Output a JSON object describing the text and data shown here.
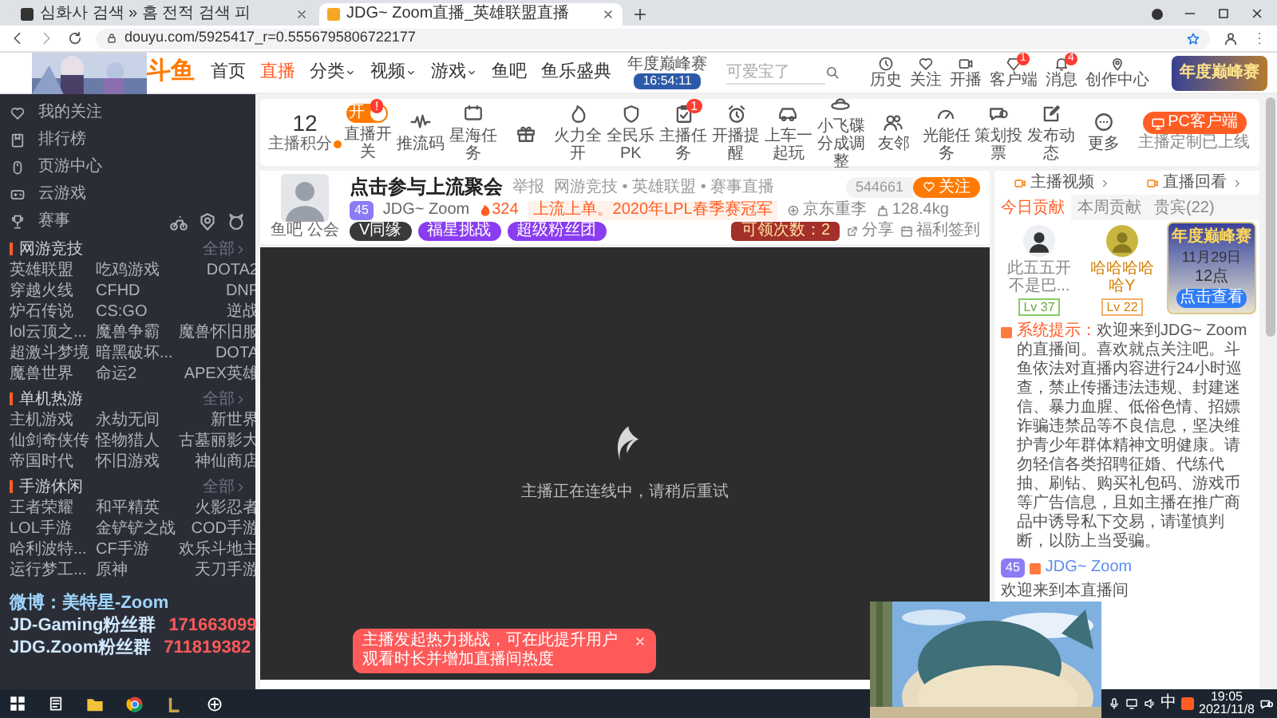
{
  "browser": {
    "tabs": [
      {
        "title": "심화사 검색 » 홈 전적 검색 피",
        "selected": false
      },
      {
        "title": "JDG~ Zoom直播_英雄联盟直播",
        "selected": true
      }
    ],
    "url": "douyu.com/5925417_r=0.5556795806722177"
  },
  "header": {
    "logo": "斗鱼",
    "nav": [
      {
        "label": "首页",
        "selected": false,
        "dropdown": false
      },
      {
        "label": "直播",
        "selected": true,
        "dropdown": false
      },
      {
        "label": "分类",
        "selected": false,
        "dropdown": true
      },
      {
        "label": "视频",
        "selected": false,
        "dropdown": true
      },
      {
        "label": "游戏",
        "selected": false,
        "dropdown": true
      },
      {
        "label": "鱼吧",
        "selected": false,
        "dropdown": false
      },
      {
        "label": "鱼乐盛典",
        "selected": false,
        "dropdown": false
      }
    ],
    "event": {
      "title": "年度巅峰赛",
      "countdown": "16:54:11"
    },
    "search": {
      "placeholder": "可爱宝了"
    },
    "actions": [
      {
        "label": "历史"
      },
      {
        "label": "关注"
      },
      {
        "label": "开播"
      },
      {
        "label": "客户端",
        "badge": "1"
      },
      {
        "label": "消息",
        "badge": "4"
      },
      {
        "label": "创作中心"
      }
    ],
    "promo": "年度巅峰赛"
  },
  "sidebar": {
    "nav": [
      {
        "label": "我的关注"
      },
      {
        "label": "排行榜"
      },
      {
        "label": "页游中心"
      },
      {
        "label": "云游戏"
      },
      {
        "label": "赛事"
      }
    ],
    "sections": [
      {
        "title": "网游竞技",
        "more": "全部",
        "items": [
          "英雄联盟",
          "吃鸡游戏",
          "DOTA2",
          "穿越火线",
          "CFHD",
          "DNF",
          "炉石传说",
          "CS:GO",
          "逆战",
          "lol云顶之...",
          "魔兽争霸",
          "魔兽怀旧服",
          "超激斗梦境",
          "暗黑破坏...",
          "DOTA",
          "魔兽世界",
          "命运2",
          "APEX英雄"
        ]
      },
      {
        "title": "单机热游",
        "more": "全部",
        "items": [
          "主机游戏",
          "永劫无间",
          "新世界",
          "仙剑奇侠传",
          "怪物猎人",
          "古墓丽影大",
          "帝国时代",
          "怀旧游戏",
          "神仙商店"
        ]
      },
      {
        "title": "手游休闲",
        "more": "全部",
        "items": [
          "王者荣耀",
          "和平精英",
          "火影忍者",
          "LOL手游",
          "金铲铲之战",
          "COD手游",
          "哈利波特...",
          "CF手游",
          "欢乐斗地主",
          "运行梦工...",
          "原神",
          "天刀手游"
        ]
      }
    ],
    "overlay": {
      "weibo": "微博：美特星-Zoom",
      "groups": [
        {
          "name": "JD-Gaming粉丝群",
          "number": "171663099"
        },
        {
          "name": "JDG.Zoom粉丝群",
          "number": "711819382"
        }
      ]
    }
  },
  "toolbar": {
    "score": {
      "value": "12",
      "label": "主播积分"
    },
    "tools": [
      {
        "kind": "toggle",
        "label": "直播开关",
        "toggle_text": "开",
        "on": true,
        "badge": "!"
      },
      {
        "kind": "button",
        "label": "推流码"
      },
      {
        "kind": "button",
        "label": "星海任务"
      },
      {
        "kind": "button"
      },
      {
        "kind": "button",
        "label": "火力全开"
      },
      {
        "kind": "button",
        "label": "全民乐PK"
      },
      {
        "kind": "button",
        "label": "主播任务",
        "badge": "1"
      },
      {
        "kind": "button",
        "label": "开播提醒"
      },
      {
        "kind": "button",
        "label": "上车一起玩"
      },
      {
        "kind": "button",
        "label": "小飞碟分成调整"
      },
      {
        "kind": "button",
        "label": "友邻"
      },
      {
        "kind": "button",
        "label": "光能任务"
      },
      {
        "kind": "button",
        "label": "策划投票"
      },
      {
        "kind": "button",
        "label": "发布动态"
      },
      {
        "kind": "button",
        "label": "更多"
      }
    ],
    "pc_client": {
      "label": "PC客户端",
      "note": "主播定制已上线"
    }
  },
  "streamer": {
    "avatar_labels": [
      "鱼吧",
      "公会"
    ],
    "title": "点击参与上流聚会",
    "report": "举报",
    "category": "网游竞技 • 英雄联盟 • 赛事直播",
    "level": "45",
    "name": "JDG~ Zoom",
    "heat": "324",
    "tagline": "上流上单。2020年LPL春季赛冠军",
    "location": "京东重李",
    "weight": "128.4kg",
    "badges": [
      "V同缘",
      "福星挑战",
      "超级粉丝团"
    ],
    "followers": "544661",
    "follow": "关注",
    "claim": "可领次数：2",
    "share": "分享",
    "checkin": "福利签到"
  },
  "video": {
    "status": "主播正在连线中，请稍后重试",
    "toast": "主播发起热力挑战，可在此提升用户观看时长并增加直播间热度"
  },
  "panel": {
    "links": [
      "主播视频",
      "直播回看"
    ],
    "tabs": [
      {
        "label": "今日贡献",
        "selected": true
      },
      {
        "label": "本周贡献",
        "selected": false
      },
      {
        "label": "贵宾(22)",
        "selected": false
      }
    ],
    "ranking": [
      {
        "name": "此五五开不是巴...",
        "level": "Lv 37"
      },
      {
        "name": "哈哈哈哈哈Y",
        "level": "Lv 22"
      }
    ],
    "chat": [
      {
        "kind": "system",
        "label": "系统提示：",
        "text": "欢迎来到JDG~ Zoom的直播间。喜欢就点关注吧。斗鱼依法对直播内容进行24小时巡查，禁止传播违法违规、封建迷信、暴力血腥、低俗色情、招嫖诈骗违禁品等不良信息，坚决维护青少年群体精神文明健康。请勿轻信各类招聘征婚、代练代抽、刷钻、购买礼包码、游戏币等广告信息，且如主播在推广商品中诱导私下交易，请谨慎判断，以防上当受骗。"
      },
      {
        "kind": "welcome",
        "level": "45",
        "user": "JDG~ Zoom",
        "text": "欢迎来到本直播间"
      }
    ],
    "promo": {
      "title": "年度巅峰赛",
      "date": "11月29日",
      "hour": "12点",
      "button": "点击查看"
    }
  },
  "taskbar": {
    "ime": "中",
    "time": "19:05",
    "date": "2021/11/8"
  }
}
